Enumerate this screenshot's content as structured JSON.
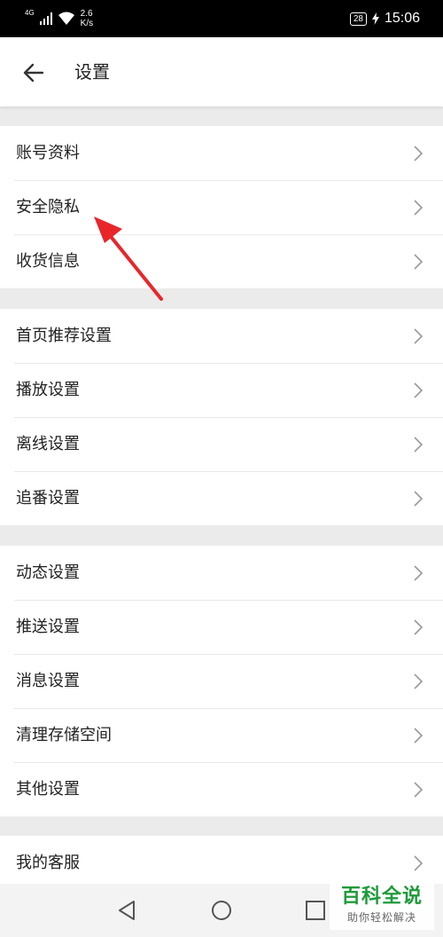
{
  "status_bar": {
    "network": "4G",
    "speed_value": "2.6",
    "speed_unit": "K/s",
    "battery": "28",
    "time": "15:06"
  },
  "header": {
    "title": "设置",
    "back_icon": "arrow-left-icon"
  },
  "groups": [
    {
      "items": [
        {
          "label": "账号资料"
        },
        {
          "label": "安全隐私"
        },
        {
          "label": "收货信息"
        }
      ]
    },
    {
      "items": [
        {
          "label": "首页推荐设置"
        },
        {
          "label": "播放设置"
        },
        {
          "label": "离线设置"
        },
        {
          "label": "追番设置"
        }
      ]
    },
    {
      "items": [
        {
          "label": "动态设置"
        },
        {
          "label": "推送设置"
        },
        {
          "label": "消息设置"
        },
        {
          "label": "清理存储空间"
        },
        {
          "label": "其他设置"
        }
      ]
    },
    {
      "items": [
        {
          "label": "我的客服"
        }
      ]
    }
  ],
  "nav": {
    "back_icon": "triangle-back-icon",
    "home_icon": "circle-home-icon",
    "recents_icon": "square-recents-icon"
  },
  "watermark": {
    "main": "百科全说",
    "sub": "助你轻松解决"
  },
  "colors": {
    "annotation_arrow": "#e8262a",
    "watermark_green": "#1e9b3a"
  }
}
